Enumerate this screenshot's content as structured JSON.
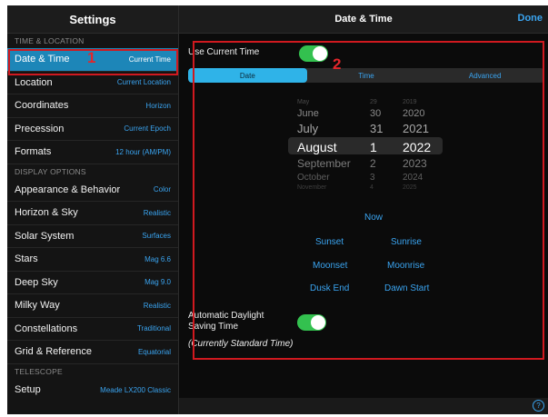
{
  "sidebar": {
    "title": "Settings",
    "sections": {
      "time_location": "TIME & LOCATION",
      "display_options": "DISPLAY OPTIONS",
      "telescope": "TELESCOPE"
    },
    "items": [
      {
        "label": "Date & Time",
        "value": "Current Time"
      },
      {
        "label": "Location",
        "value": "Current Location"
      },
      {
        "label": "Coordinates",
        "value": "Horizon"
      },
      {
        "label": "Precession",
        "value": "Current Epoch"
      },
      {
        "label": "Formats",
        "value": "12 hour (AM/PM)"
      },
      {
        "label": "Appearance & Behavior",
        "value": "Color"
      },
      {
        "label": "Horizon & Sky",
        "value": "Realistic"
      },
      {
        "label": "Solar System",
        "value": "Surfaces"
      },
      {
        "label": "Stars",
        "value": "Mag 6.6"
      },
      {
        "label": "Deep Sky",
        "value": "Mag 9.0"
      },
      {
        "label": "Milky Way",
        "value": "Realistic"
      },
      {
        "label": "Constellations",
        "value": "Traditional"
      },
      {
        "label": "Grid & Reference",
        "value": "Equatorial"
      },
      {
        "label": "Setup",
        "value": "Meade LX200 Classic"
      }
    ]
  },
  "main": {
    "title": "Date & Time",
    "done_label": "Done",
    "use_current_time_label": "Use Current Time",
    "use_current_time_on": true,
    "tabs": [
      {
        "label": "Date"
      },
      {
        "label": "Time"
      },
      {
        "label": "Advanced"
      }
    ],
    "picker": {
      "rows": [
        {
          "month": "May",
          "day": "29",
          "year": "2019"
        },
        {
          "month": "June",
          "day": "30",
          "year": "2020"
        },
        {
          "month": "July",
          "day": "31",
          "year": "2021"
        },
        {
          "month": "August",
          "day": "1",
          "year": "2022"
        },
        {
          "month": "September",
          "day": "2",
          "year": "2023"
        },
        {
          "month": "October",
          "day": "3",
          "year": "2024"
        },
        {
          "month": "November",
          "day": "4",
          "year": "2025"
        }
      ]
    },
    "buttons": {
      "now": "Now",
      "sunset": "Sunset",
      "sunrise": "Sunrise",
      "moonset": "Moonset",
      "moonrise": "Moonrise",
      "dusk_end": "Dusk End",
      "dawn_start": "Dawn Start"
    },
    "auto_dst_label_line1": "Automatic Daylight",
    "auto_dst_label_line2": "Saving Time",
    "auto_dst_on": true,
    "current_standard_time": "(Currently Standard Time)",
    "help_label": "?"
  },
  "annotations": {
    "marker_1": "1",
    "marker_2": "2"
  },
  "colors": {
    "accent": "#3aa4f0",
    "selected_row": "#1d86b8",
    "toggle_on": "#33c14f",
    "annotation_red": "#d0191f"
  }
}
